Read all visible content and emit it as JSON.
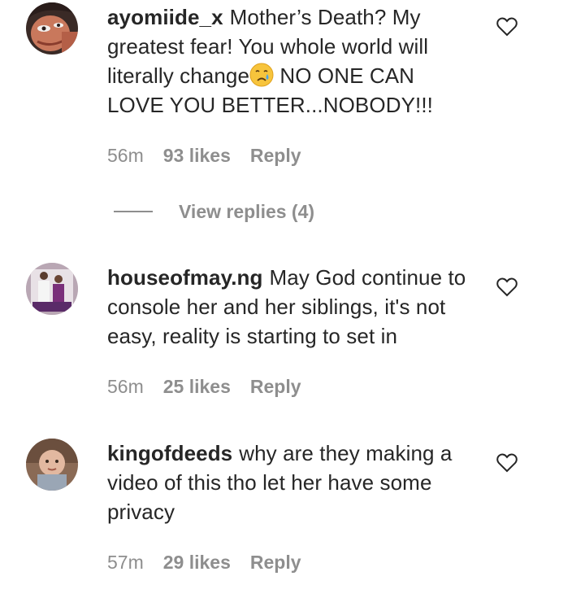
{
  "comments": [
    {
      "username": "ayomiide_x",
      "text": "Mother’s Death? My greatest fear! You whole world will literally change",
      "emoji": "crying-face-emoji",
      "text_after": " NO ONE CAN LOVE YOU BETTER...NOBODY!!!",
      "time": "56m",
      "likes": "93 likes",
      "reply_label": "Reply",
      "view_replies": "View replies (4)"
    },
    {
      "username": "houseofmay.ng",
      "text": "May God continue to console her and her siblings, it's not easy, reality is starting to set in",
      "time": "56m",
      "likes": "25 likes",
      "reply_label": "Reply"
    },
    {
      "username": "kingofdeeds",
      "text": "why are they making a video of this tho let her have some privacy",
      "time": "57m",
      "likes": "29 likes",
      "reply_label": "Reply"
    }
  ],
  "icons": {
    "like": "heart-outline-icon"
  },
  "colors": {
    "text": "#262626",
    "secondary": "#8e8e8e",
    "background": "#ffffff"
  }
}
